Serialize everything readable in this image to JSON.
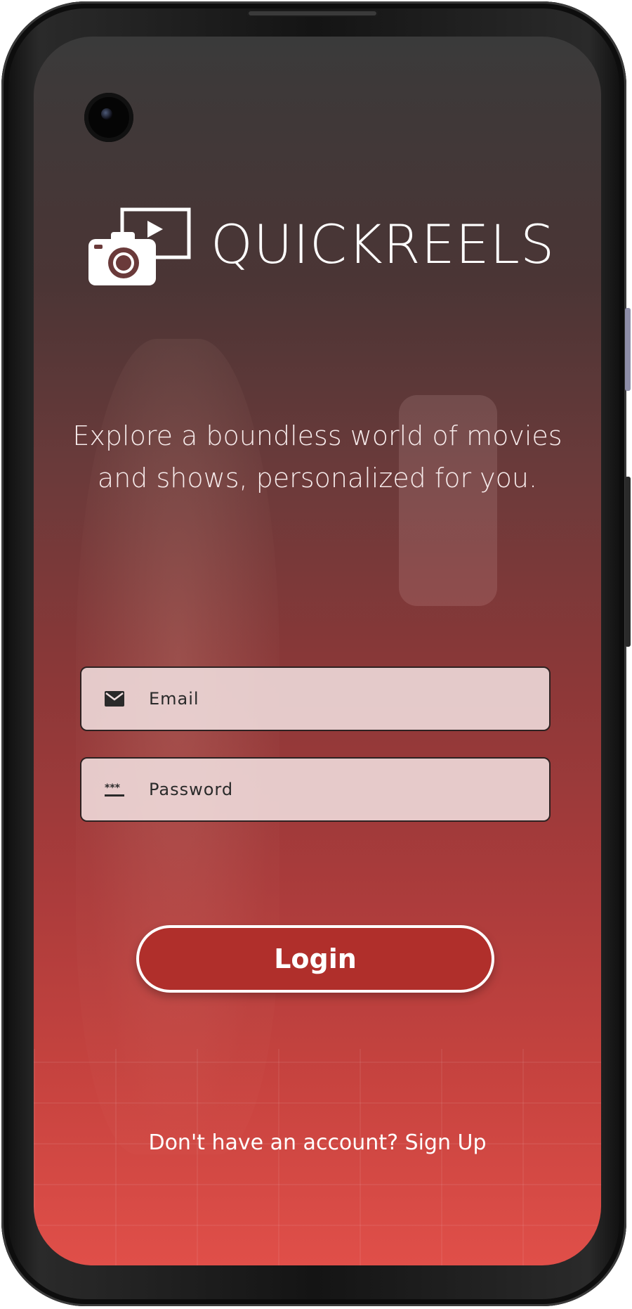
{
  "app": {
    "name": "QUICKREELS",
    "tagline": "Explore a boundless world of movies and shows, personalized for you."
  },
  "form": {
    "email_placeholder": "Email",
    "password_placeholder": "Password",
    "login_label": "Login"
  },
  "signup": {
    "prompt": "Don't have an account?",
    "link_label": "Sign Up"
  },
  "icons": {
    "logo": "camera-play-icon",
    "email": "mail-icon",
    "password": "password-dots-icon"
  },
  "colors": {
    "accent": "#b02f2b",
    "gradient_top": "#3a3a3a",
    "gradient_bottom": "#e04f49",
    "field_background": "#f0dede",
    "text_light": "#ffffff"
  }
}
